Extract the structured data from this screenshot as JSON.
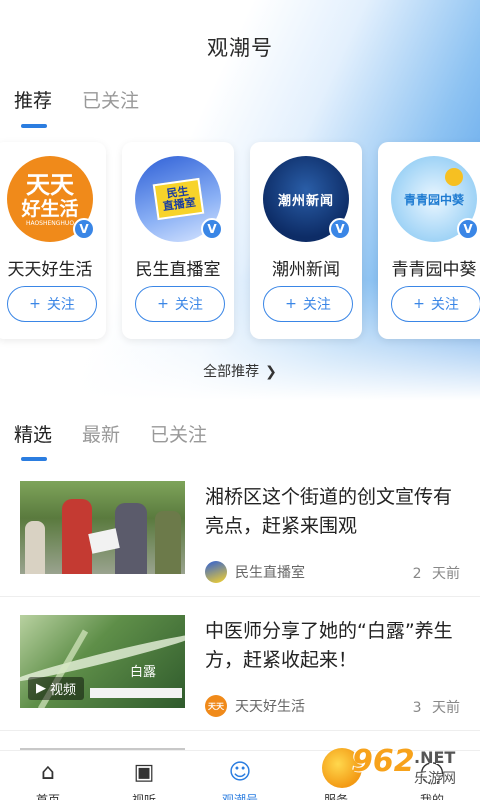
{
  "header": {
    "title": "观潮号"
  },
  "top_tabs": [
    {
      "label": "推荐",
      "active": true
    },
    {
      "label": "已关注",
      "active": false
    }
  ],
  "channels": [
    {
      "name": "天天好生活",
      "logo_text_1": "天天",
      "logo_text_2": "好生活",
      "logo_sub": "HAOSHENGHUO",
      "follow": "关注",
      "verified": "V"
    },
    {
      "name": "民生直播室",
      "logo_text_1": "民生",
      "logo_text_2": "直播室",
      "follow": "关注",
      "verified": "V"
    },
    {
      "name": "潮州新闻",
      "logo_text_1": "潮州新闻",
      "follow": "关注",
      "verified": "V"
    },
    {
      "name": "青青园中葵",
      "logo_text_1": "青青园中葵",
      "follow": "关注",
      "verified": "V"
    }
  ],
  "all_recommend": {
    "label": "全部推荐",
    "icon": "chevron-right-icon"
  },
  "feed_tabs": [
    {
      "label": "精选",
      "active": true
    },
    {
      "label": "最新",
      "active": false
    },
    {
      "label": "已关注",
      "active": false
    }
  ],
  "articles": [
    {
      "headline": "湘桥区这个街道的创文宣传有亮点，赶紧来围观",
      "source": "民生直播室",
      "time": "2 天前"
    },
    {
      "headline": "中医师分享了她的“白露”养生方，赶紧收起来！",
      "source": "天天好生活",
      "source_logo_text": "天天",
      "time": "3 天前",
      "video_badge": "视频",
      "thumb_text": "白露"
    }
  ],
  "bottom_nav": [
    {
      "label": "首页",
      "icon": "home-icon",
      "active": false
    },
    {
      "label": "视听",
      "icon": "video-icon",
      "active": false
    },
    {
      "label": "观潮号",
      "icon": "person-icon",
      "active": true
    },
    {
      "label": "服务",
      "icon": "grid-icon",
      "active": false
    },
    {
      "label": "我的",
      "icon": "user-icon",
      "active": false
    }
  ],
  "watermark": {
    "num": "962",
    "net": ".NET",
    "cn": "乐游网"
  },
  "colors": {
    "accent": "#2b7de0",
    "follow_border": "#3a86e6",
    "header_gradient_end": "#3f91e6"
  }
}
